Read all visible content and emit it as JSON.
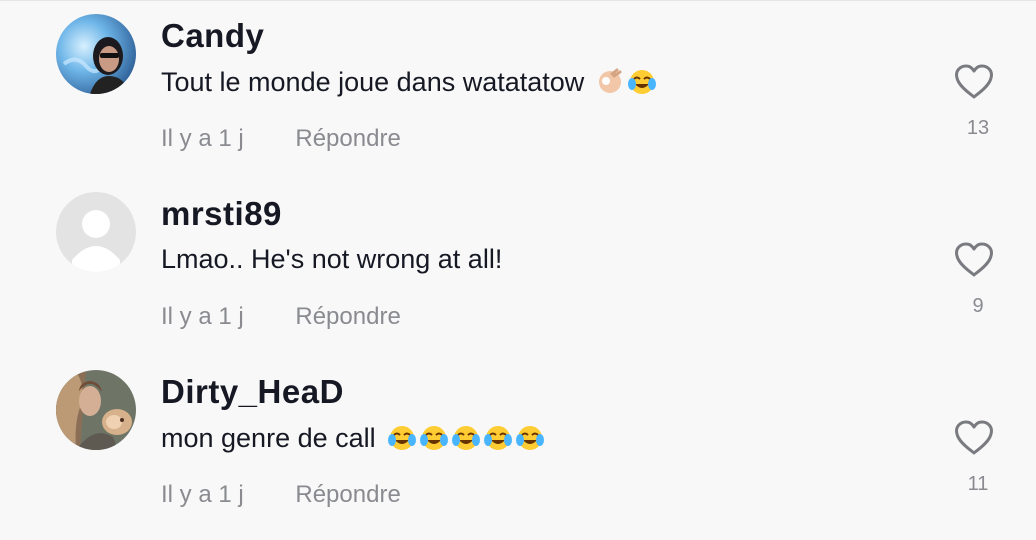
{
  "comments": [
    {
      "username": "Candy",
      "text": "Tout le monde joue dans watatatow",
      "emojis": [
        "ok-hand-emoji",
        "tears-of-joy-emoji"
      ],
      "time": "Il y a 1 j",
      "reply_label": "Répondre",
      "likes": "13",
      "avatar": "candy-avatar"
    },
    {
      "username": "mrsti89",
      "text": "Lmao.. He's not wrong at all!",
      "emojis": [],
      "time": "Il y a 1 j",
      "reply_label": "Répondre",
      "likes": "9",
      "avatar": "default-avatar"
    },
    {
      "username": "Dirty_HeaD",
      "text": "mon genre de call",
      "emojis": [
        "tears-of-joy-emoji",
        "tears-of-joy-emoji",
        "tears-of-joy-emoji",
        "tears-of-joy-emoji",
        "tears-of-joy-emoji"
      ],
      "time": "Il y a 1 j",
      "reply_label": "Répondre",
      "likes": "11",
      "avatar": "dirty-head-avatar"
    }
  ],
  "colors": {
    "background": "#f8f8f8",
    "username": "#161823",
    "secondary": "#8a8b91"
  }
}
